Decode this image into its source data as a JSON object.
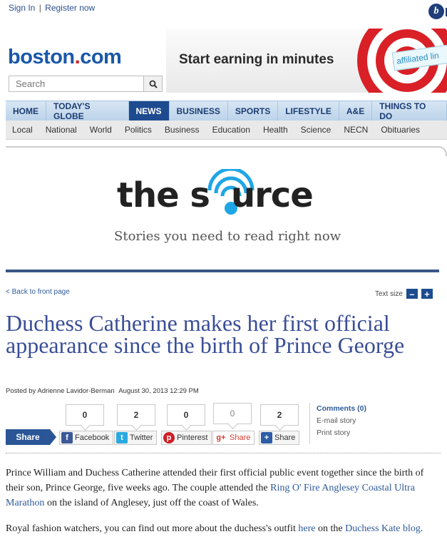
{
  "topbar": {
    "sign_in": "Sign In",
    "separator": "|",
    "register": "Register now"
  },
  "badge": {
    "letter": "b"
  },
  "logo": {
    "part1": "boston",
    "part2": ".",
    "part3": "com"
  },
  "search": {
    "placeholder": "Search"
  },
  "ad": {
    "headline": "Start earning in minutes",
    "paper_text": "affiliated lin"
  },
  "nav_primary": [
    "HOME",
    "TODAY'S GLOBE",
    "NEWS",
    "BUSINESS",
    "SPORTS",
    "LIFESTYLE",
    "A&E",
    "THINGS TO DO"
  ],
  "nav_primary_active": "NEWS",
  "nav_secondary": [
    "Local",
    "National",
    "World",
    "Politics",
    "Business",
    "Education",
    "Health",
    "Science",
    "NECN",
    "Obituaries"
  ],
  "source": {
    "word_before": "the s",
    "word_after": "urce",
    "tagline": "Stories you need to read right now"
  },
  "article": {
    "back_link": "< Back to front page",
    "text_size_label": "Text size",
    "text_size_minus": "–",
    "text_size_plus": "+",
    "title": "Duchess Catherine makes her first official appearance since the birth of Prince George",
    "byline_prefix": "Posted by",
    "author": "Adrienne Lavidor-Berman",
    "date": "August 30, 2013 12:29 PM",
    "para1": {
      "t1": "Prince William and Duchess Catherine attended their first official public event together since the birth of their son, Prince George, five weeks ago. The couple attended the ",
      "link": "Ring O' Fire Anglesey Coastal Ultra Marathon",
      "t2": " on the island of Anglesey, just off the coast of Wales."
    },
    "para2": {
      "t1": "Royal fashion watchers, you can find out more about the duchess's outfit ",
      "link1": "here",
      "t2": " on the ",
      "link2": "Duchess Kate blog",
      "t3": "."
    }
  },
  "share": {
    "button": "Share",
    "counts": [
      "0",
      "2",
      "0",
      "0",
      "2"
    ],
    "buttons": [
      {
        "label": "Facebook",
        "icon": "f",
        "icon_name": "facebook-icon",
        "color": "#3b5998"
      },
      {
        "label": "Twitter",
        "icon": "t",
        "icon_name": "twitter-icon",
        "color": "#2aa9e0"
      },
      {
        "label": "Pinterest",
        "icon": "p",
        "icon_name": "pinterest-icon",
        "color": "#cb2027"
      },
      {
        "label": "Share",
        "icon": "g+",
        "icon_name": "google-plus-icon",
        "color": "#d73d32"
      },
      {
        "label": "Share",
        "icon": "+",
        "icon_name": "addthis-plus-icon",
        "color": "#2d5da6"
      }
    ]
  },
  "sidelinks": {
    "comments": "Comments (0)",
    "email": "E-mail story",
    "print": "Print story"
  },
  "colors": {
    "brand_blue": "#1a58a8",
    "brand_red": "#d1242a",
    "nav_active": "#1e4b8f",
    "title": "#3a4e96",
    "source_accent": "#1fa6e6"
  }
}
